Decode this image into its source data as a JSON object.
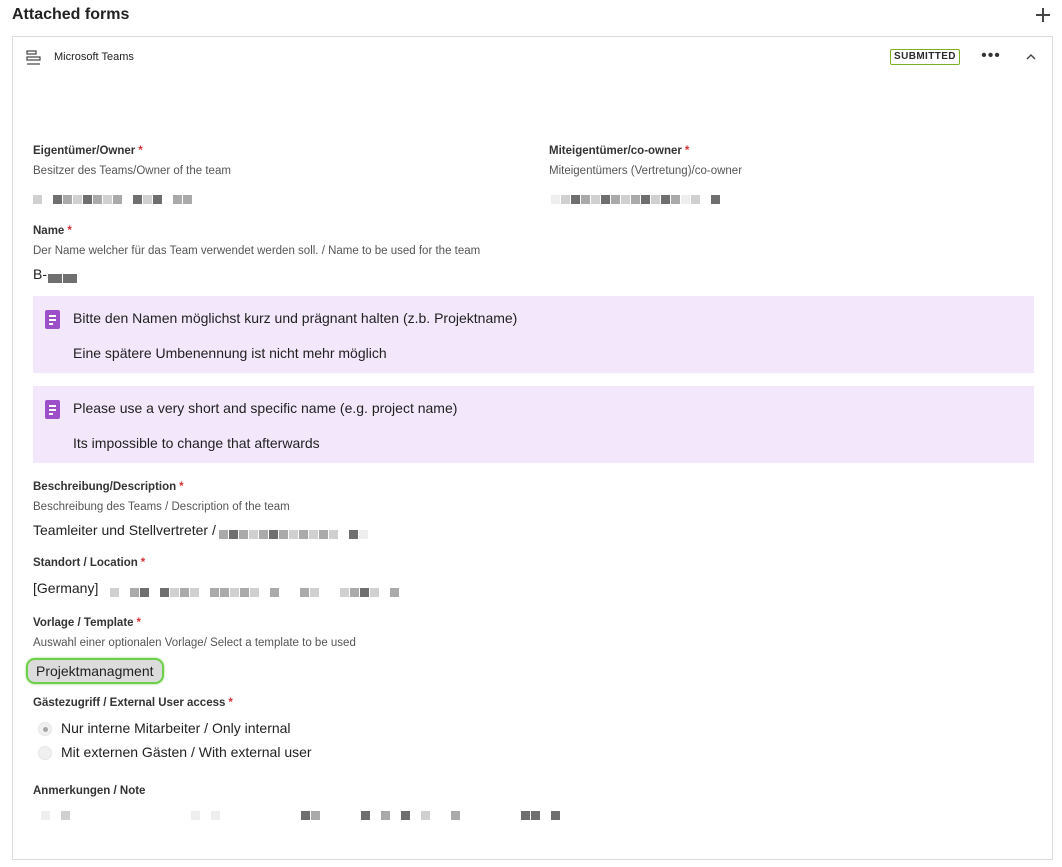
{
  "header": {
    "title": "Attached forms",
    "add_icon": "plus-icon"
  },
  "form": {
    "name": "Microsoft Teams",
    "icon": "form-list-icon",
    "status": "SUBMITTED",
    "status_color": "#7bb21d",
    "more_icon": "more-horizontal-icon",
    "more_label": "•••",
    "collapse_icon": "chevron-up-icon"
  },
  "fields": {
    "owner": {
      "label": "Eigentümer/Owner",
      "required": "*",
      "help": "Besitzer des Teams/Owner of the team"
    },
    "coowner": {
      "label": "Miteigentümer/co-owner",
      "required": "*",
      "help": "Miteigentümers (Vertretung)/co-owner"
    },
    "name": {
      "label": "Name",
      "required": "*",
      "help": "Der Name welcher für das Team verwendet werden soll. / Name to be used for the team",
      "value": "B-"
    },
    "info_de": {
      "line1": "Bitte den Namen möglichst kurz und prägnant halten (z.b. Projektname)",
      "line2": "Eine spätere Umbenennung ist nicht mehr möglich"
    },
    "info_en": {
      "line1": "Please use a very short and specific name (e.g. project name)",
      "line2": "Its impossible to change that afterwards"
    },
    "description": {
      "label": "Beschreibung/Description",
      "required": "*",
      "help": "Beschreibung des Teams / Description of the team",
      "value": "Teamleiter und Stellvertreter /"
    },
    "location": {
      "label": "Standort / Location",
      "required": "*",
      "value": "[Germany]"
    },
    "template": {
      "label": "Vorlage / Template",
      "required": "*",
      "help": "Auswahl einer optionalen Vorlage/ Select a template to be used",
      "value": "Projektmanagment"
    },
    "guest_access": {
      "label": "Gästezugriff / External User access",
      "required": "*",
      "options": [
        {
          "label": "Nur interne Mitarbeiter / Only internal",
          "checked": true
        },
        {
          "label": "Mit externen Gästen / With external user",
          "checked": false
        }
      ]
    },
    "note": {
      "label": "Anmerkungen / Note"
    }
  },
  "colors": {
    "required": "#d13438",
    "info_bg": "#f3e8fb",
    "info_icon": "#9d4fc9",
    "highlight": "#6ecf4a"
  }
}
